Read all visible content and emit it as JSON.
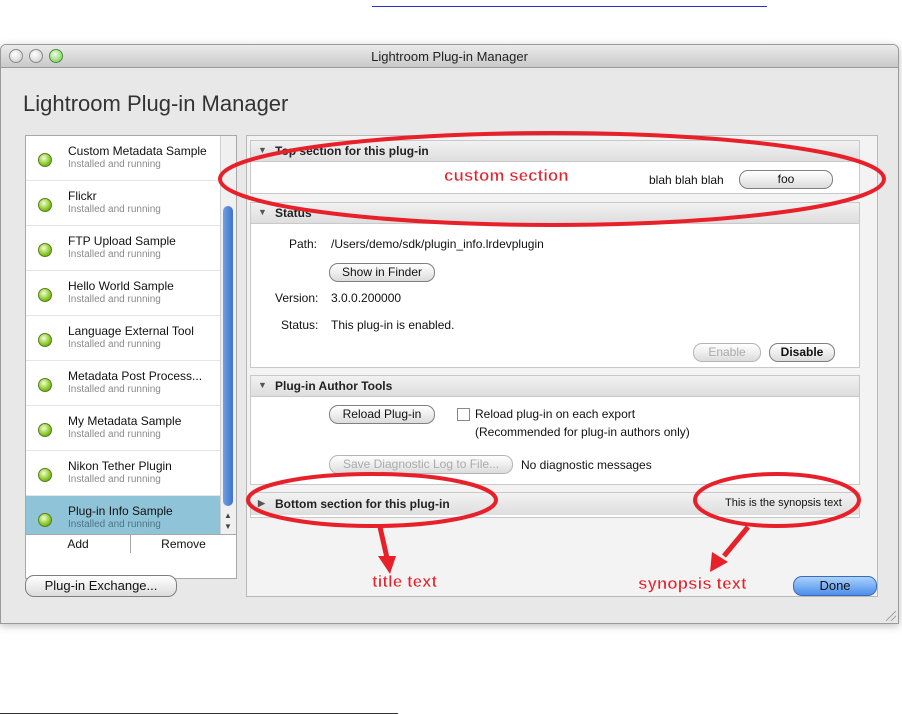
{
  "window": {
    "title": "Lightroom Plug-in Manager",
    "heading": "Lightroom Plug-in Manager"
  },
  "plugins": [
    {
      "name": "Custom Metadata Sample",
      "status": "Installed and running"
    },
    {
      "name": "Flickr",
      "status": "Installed and running"
    },
    {
      "name": "FTP Upload Sample",
      "status": "Installed and running"
    },
    {
      "name": "Hello World Sample",
      "status": "Installed and running"
    },
    {
      "name": "Language External Tool",
      "status": "Installed and running"
    },
    {
      "name": "Metadata Post Process...",
      "status": "Installed and running"
    },
    {
      "name": "My Metadata Sample",
      "status": "Installed and running"
    },
    {
      "name": "Nikon Tether Plugin",
      "status": "Installed and running"
    },
    {
      "name": "Plug-in Info Sample",
      "status": "Installed and running",
      "selected": true
    }
  ],
  "list_buttons": {
    "add": "Add",
    "remove": "Remove"
  },
  "sections": {
    "top": {
      "title": "Top section for this plug-in",
      "text": "blah blah blah",
      "button": "foo"
    },
    "status": {
      "title": "Status",
      "path_label": "Path:",
      "path_value": "/Users/demo/sdk/plugin_info.lrdevplugin",
      "show_in_finder": "Show in Finder",
      "version_label": "Version:",
      "version_value": "3.0.0.200000",
      "status_label": "Status:",
      "status_value": "This plug-in is enabled.",
      "enable": "Enable",
      "disable": "Disable"
    },
    "author": {
      "title": "Plug-in Author Tools",
      "reload": "Reload Plug-in",
      "reload_check": "Reload plug-in on each export",
      "recommend": "(Recommended for plug-in authors only)",
      "save_log": "Save Diagnostic Log to File...",
      "no_diag": "No diagnostic messages"
    },
    "bottom": {
      "title": "Bottom section for this plug-in",
      "synopsis": "This is the synopsis text"
    }
  },
  "footer": {
    "exchange": "Plug-in Exchange...",
    "done": "Done"
  },
  "annotations": {
    "custom": "custom section",
    "title": "title text",
    "synopsis": "synopsis text"
  },
  "colors": {
    "annotation": "#e8202a",
    "selection": "#8fc3d7",
    "done_button": "#4c8ee8"
  }
}
